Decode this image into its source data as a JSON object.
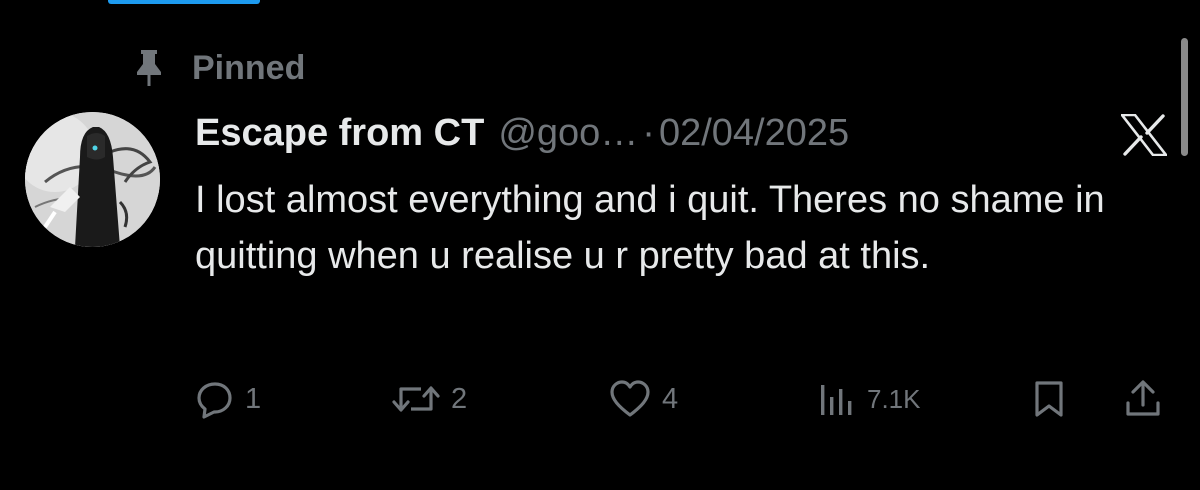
{
  "pinned": {
    "label": "Pinned"
  },
  "tweet": {
    "display_name": "Escape from CT",
    "handle": "@goo…",
    "separator": "·",
    "date": "02/04/2025",
    "text": "I lost almost everything and i quit. Theres no shame in quitting when u realise u r pretty bad at this."
  },
  "actions": {
    "replies": "1",
    "reposts": "2",
    "likes": "4",
    "views": "7.1K"
  },
  "icons": {
    "pin": "pin-icon",
    "reply": "reply-icon",
    "repost": "repost-icon",
    "like": "heart-icon",
    "views": "views-icon",
    "bookmark": "bookmark-icon",
    "share": "share-icon",
    "logo": "x-logo-icon"
  },
  "colors": {
    "background": "#000000",
    "text_primary": "#e7e9ea",
    "text_secondary": "#71767b",
    "accent": "#1d9bf0"
  }
}
